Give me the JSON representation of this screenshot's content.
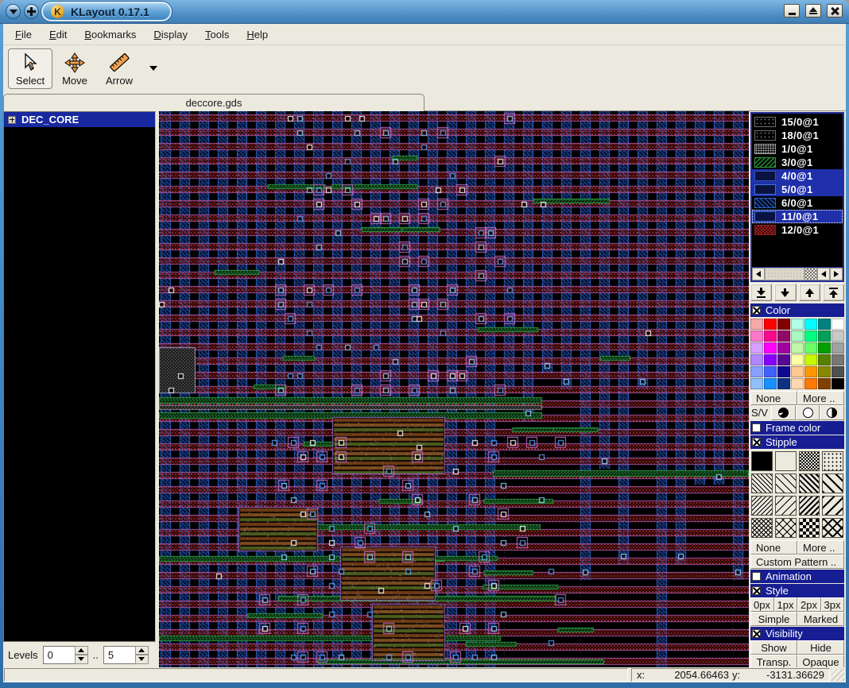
{
  "window": {
    "title": "KLayout 0.17.1",
    "logo_glyph": "K"
  },
  "menubar": {
    "items": [
      {
        "label": "File"
      },
      {
        "label": "Edit"
      },
      {
        "label": "Bookmarks"
      },
      {
        "label": "Display"
      },
      {
        "label": "Tools"
      },
      {
        "label": "Help"
      }
    ]
  },
  "toolbar": {
    "buttons": [
      {
        "label": "Select",
        "icon": "cursor-icon",
        "active": true
      },
      {
        "label": "Move",
        "icon": "move-icon",
        "active": false
      },
      {
        "label": "Arrow",
        "icon": "ruler-icon",
        "active": false
      }
    ]
  },
  "tabs": {
    "active_label": "deccore.gds"
  },
  "cell_tree": {
    "cells": [
      {
        "name": "DEC_CORE",
        "selected": true,
        "expandable": true
      }
    ]
  },
  "levels": {
    "label": "Levels",
    "from": "0",
    "separator": "..",
    "to": "5"
  },
  "layer_panel": {
    "layers": [
      {
        "name": "15/0@1",
        "pattern": "dots-dark",
        "selected": false,
        "focus": false
      },
      {
        "name": "18/0@1",
        "pattern": "dots-dark",
        "selected": false,
        "focus": false
      },
      {
        "name": "1/0@1",
        "pattern": "dots-gray",
        "selected": false,
        "focus": false
      },
      {
        "name": "3/0@1",
        "pattern": "hatch-green",
        "selected": false,
        "focus": false
      },
      {
        "name": "4/0@1",
        "pattern": "solid-navy",
        "selected": true,
        "focus": false
      },
      {
        "name": "5/0@1",
        "pattern": "solid-navy2",
        "selected": true,
        "focus": false
      },
      {
        "name": "6/0@1",
        "pattern": "hatch-blue",
        "selected": false,
        "focus": false
      },
      {
        "name": "11/0@1",
        "pattern": "solid-navy2",
        "selected": true,
        "focus": true
      },
      {
        "name": "12/0@1",
        "pattern": "cross-red",
        "selected": false,
        "focus": false
      }
    ]
  },
  "color_section": {
    "title": "Color",
    "checked": true,
    "palette": [
      "#f8a8a8",
      "#ff0000",
      "#800000",
      "#b0ffe8",
      "#00ffff",
      "#008080",
      "#ffffff",
      "#ff78c8",
      "#ff0890",
      "#900868",
      "#a8f8c0",
      "#00ff80",
      "#00a058",
      "#c8c8c8",
      "#d8a0ff",
      "#ff00ff",
      "#a000a0",
      "#c0f8a8",
      "#68ff68",
      "#00a000",
      "#a0a0a0",
      "#b088ff",
      "#8800ff",
      "#580890",
      "#ffffa8",
      "#c8f800",
      "#588000",
      "#787878",
      "#88a0ff",
      "#4060ff",
      "#100890",
      "#ffc890",
      "#ff9800",
      "#888800",
      "#505050",
      "#90c0ff",
      "#1890ff",
      "#103080",
      "#ffd8b0",
      "#ff7800",
      "#804000",
      "#000000"
    ],
    "buttons": [
      "None",
      "More .."
    ]
  },
  "sv_row": {
    "label": "S/V"
  },
  "frame_color_section": {
    "title": "Frame color",
    "checked": false
  },
  "stipple_section": {
    "title": "Stipple",
    "checked": true,
    "patterns": [
      "solid",
      "empty",
      "checker-fine",
      "dots",
      "bslash-dense",
      "bslash",
      "bslash-bold",
      "bslash-wide",
      "fslash-dense",
      "fslash",
      "fslash-bold",
      "fslash-wide",
      "cross-fine",
      "cross",
      "checker",
      "cross-bold"
    ],
    "buttons": [
      "None",
      "More .."
    ],
    "custom_label": "Custom Pattern .."
  },
  "animation_section": {
    "title": "Animation",
    "checked": false
  },
  "style_section": {
    "title": "Style",
    "checked": true,
    "widths": [
      "0px",
      "1px",
      "2px",
      "3px"
    ],
    "modes": [
      "Simple",
      "Marked"
    ]
  },
  "visibility_section": {
    "title": "Visibility",
    "checked": true,
    "row1": [
      "Show",
      "Hide"
    ],
    "row2": [
      "Transp.",
      "Opaque"
    ]
  },
  "status_bar": {
    "x_label": "x:",
    "x_value": "2054.66463",
    "y_label": "y:",
    "y_value": "-3131.36629"
  },
  "canvas": {
    "bg": "#000000",
    "band_fill": "#b02828",
    "band_dark": "#701414",
    "band_edge": "#a757a7",
    "col_line": "#2b66cc",
    "col_fill": "#04102c",
    "green": "#2f9e40",
    "green_dark": "#03160a",
    "gray_dot": "#909090",
    "via_colors": [
      "#ffffff",
      "#8cd6ff",
      "#58a2ff"
    ],
    "box_color": "#c668c6",
    "brown1": "#6e3a16",
    "brown2": "#7c4c20",
    "olive": "#4c5c1e",
    "block_edge": "#9a68c8"
  }
}
